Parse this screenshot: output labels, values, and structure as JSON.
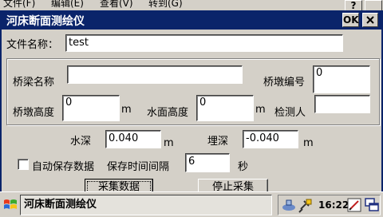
{
  "menubar": {
    "items": [
      "文件(F)",
      "编辑(E)",
      "查看(V)",
      "转到(G)"
    ],
    "help_label": "?"
  },
  "window": {
    "title": "河床断面测绘仪",
    "ok_label": "OK",
    "close_label": "×"
  },
  "form": {
    "file_name_label": "文件名称：",
    "file_name_value": "test",
    "bridge_name_label": "桥梁名称",
    "bridge_name_value": "",
    "pier_number_label": "桥墩编号",
    "pier_number_value": "0",
    "pier_height_label": "桥墩高度",
    "pier_height_value": "0",
    "pier_height_unit": "m",
    "water_level_label": "水面高度",
    "water_level_value": "0",
    "water_level_unit": "m",
    "inspector_label": "检测人",
    "inspector_value": "",
    "water_depth_label": "水深",
    "water_depth_value": "0.040",
    "water_depth_unit": "m",
    "burial_depth_label": "埋深",
    "burial_depth_value": "-0.040",
    "burial_depth_unit": "m",
    "auto_save_label": "自动保存数据",
    "auto_save_checked": false,
    "save_interval_label": "保存时间间隔",
    "save_interval_value": "6",
    "save_interval_unit": "秒",
    "collect_button": "采集数据",
    "stop_button": "停止采集"
  },
  "taskbar": {
    "task_label": "河床断面测绘仪",
    "clock": "16:22"
  },
  "colors": {
    "titlebar": "#0a246a",
    "face": "#d4d0c8"
  }
}
